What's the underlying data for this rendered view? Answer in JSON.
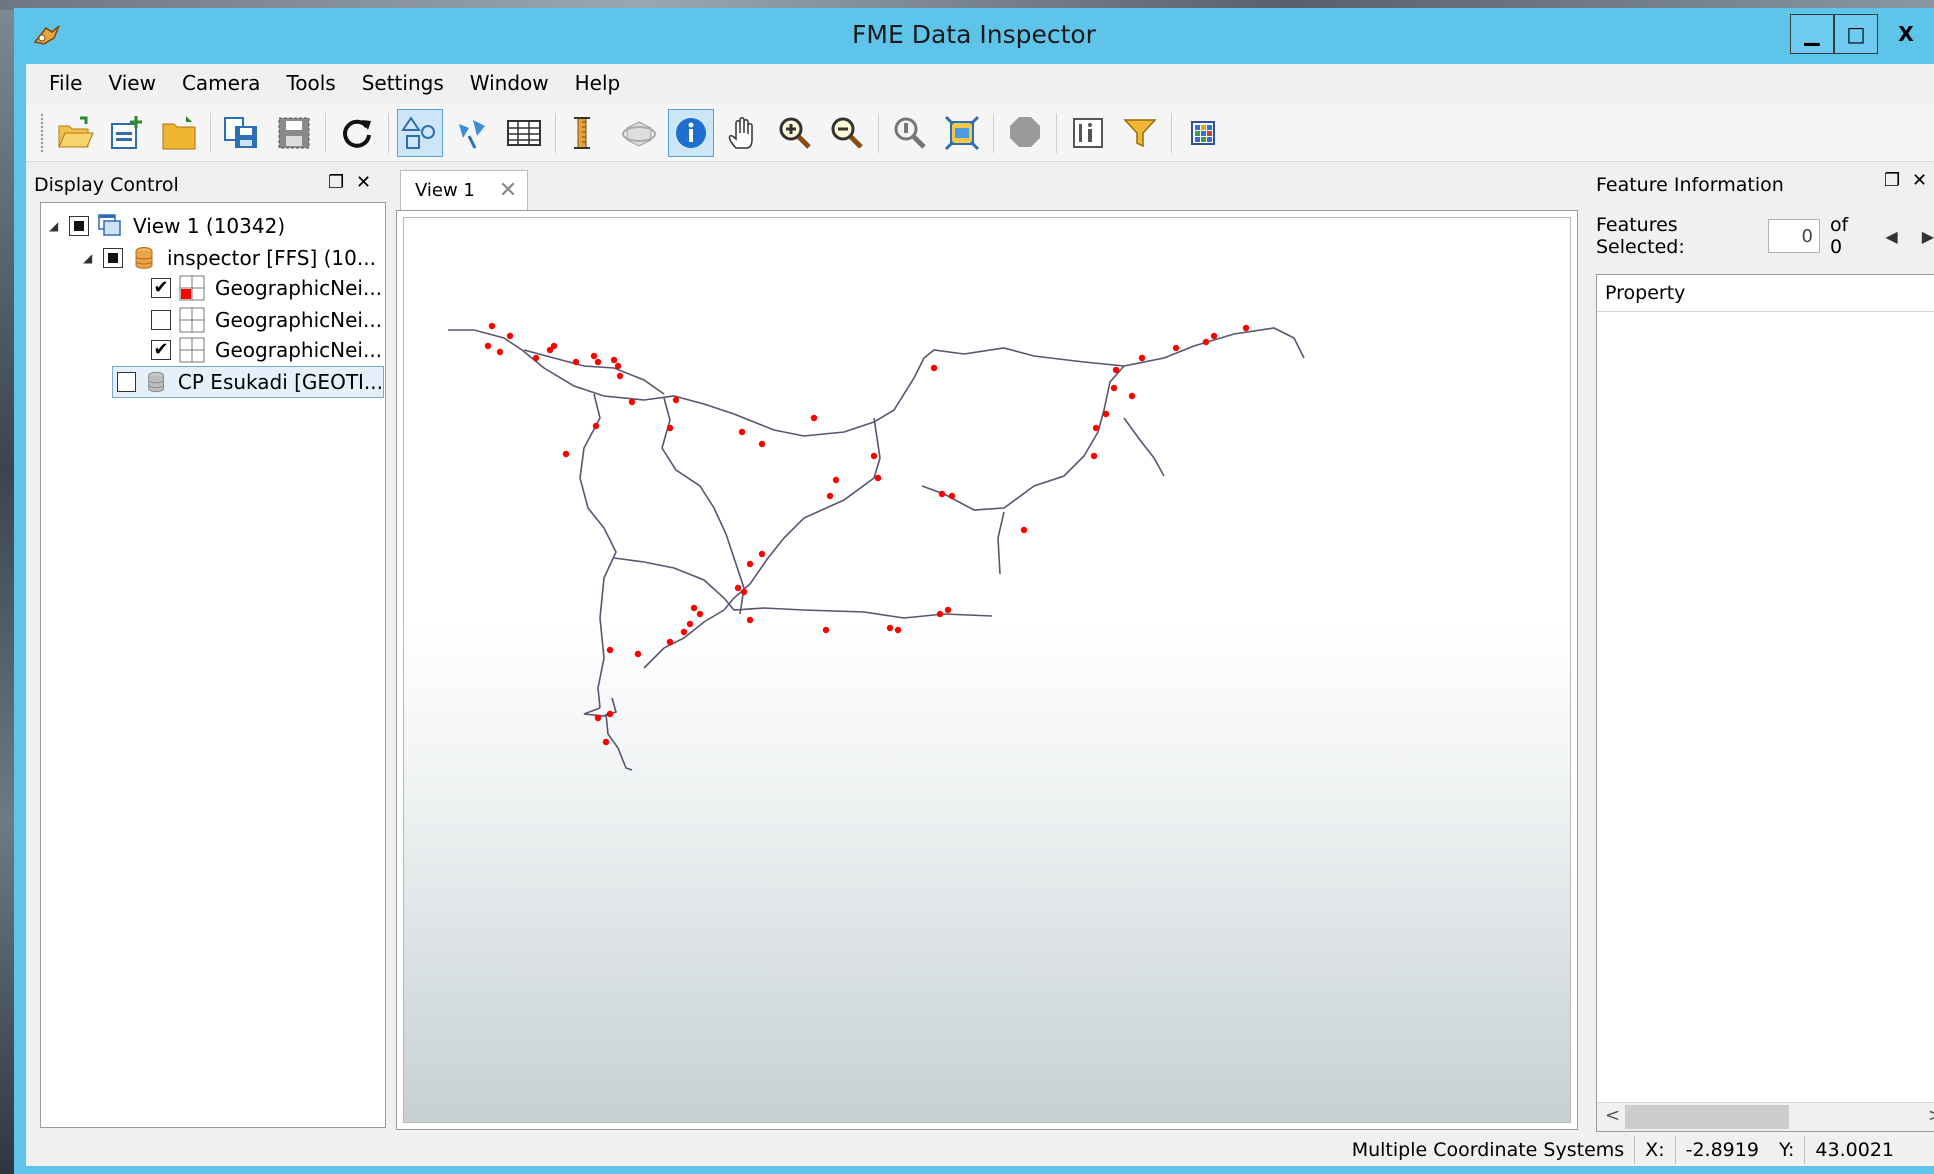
{
  "window": {
    "title": "FME Data Inspector",
    "minimize": "▁",
    "maximize": "□",
    "close": "X"
  },
  "menubar": {
    "items": [
      "File",
      "View",
      "Camera",
      "Tools",
      "Settings",
      "Window",
      "Help"
    ]
  },
  "toolbar": {
    "buttons": [
      {
        "name": "open-dataset-icon"
      },
      {
        "name": "add-dataset-icon"
      },
      {
        "name": "open-folder-icon"
      },
      {
        "name": "save-as-icon"
      },
      {
        "name": "save-icon"
      },
      {
        "name": "refresh-icon"
      },
      {
        "name": "select-tool-icon",
        "active": true
      },
      {
        "name": "vertex-tool-icon"
      },
      {
        "name": "table-view-icon"
      },
      {
        "name": "measure-icon"
      },
      {
        "name": "orbit-3d-icon"
      },
      {
        "name": "info-icon",
        "active": true
      },
      {
        "name": "pan-hand-icon"
      },
      {
        "name": "zoom-in-icon"
      },
      {
        "name": "zoom-out-icon"
      },
      {
        "name": "zoom-find-icon"
      },
      {
        "name": "zoom-extents-icon"
      },
      {
        "name": "stop-icon"
      },
      {
        "name": "feature-info-icon"
      },
      {
        "name": "filter-icon"
      },
      {
        "name": "background-map-icon"
      }
    ]
  },
  "display_control": {
    "title": "Display Control",
    "float_icon": "❐",
    "close_icon": "✕",
    "tree": [
      {
        "label": "View 1 (10342)",
        "state": "partial",
        "level": 0,
        "expander": "◢"
      },
      {
        "label": "inspector [FFS] (10...",
        "state": "partial",
        "level": 1,
        "expander": "◢"
      },
      {
        "label": "GeographicNei...",
        "state": "checked",
        "level": 2
      },
      {
        "label": "GeographicNei...",
        "state": "unchecked",
        "level": 2
      },
      {
        "label": "GeographicNei...",
        "state": "checked",
        "level": 2
      },
      {
        "label": "CP Esukadi [GEOTI...",
        "state": "unchecked",
        "level": 1,
        "selected": true
      }
    ]
  },
  "view": {
    "tab_label": "View 1",
    "tab_close": "✕",
    "line_color": "#5a5470",
    "point_color": "#ff0000"
  },
  "feature_information": {
    "title": "Feature Information",
    "float_icon": "❐",
    "close_icon": "✕",
    "features_selected_label": "Features Selected:",
    "features_selected_value": "0",
    "of_label": "of 0",
    "prev": "◀",
    "next": "▶",
    "table_header": "Property",
    "scroll_left": "<",
    "scroll_right": ">"
  },
  "statusbar": {
    "coord_system": "Multiple Coordinate Systems",
    "x_label": "X:",
    "x_value": "-2.8919",
    "y_label": "Y:",
    "y_value": "43.0021"
  }
}
